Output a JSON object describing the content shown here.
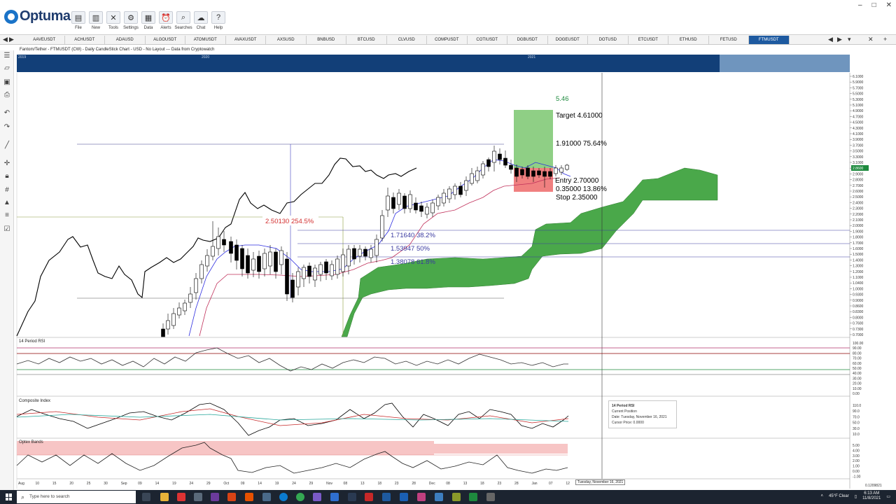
{
  "app": {
    "name": "Optuma"
  },
  "ribbon": {
    "buttons": [
      {
        "label": "File",
        "icon": "folder-icon",
        "glyph": "▤"
      },
      {
        "label": "New",
        "icon": "new-doc-icon",
        "glyph": "▥"
      },
      {
        "label": "Tools",
        "icon": "tools-icon",
        "glyph": "✕"
      },
      {
        "label": "Settings",
        "icon": "gear-icon",
        "glyph": "⚙"
      },
      {
        "label": "Data",
        "icon": "data-icon",
        "glyph": "▦"
      },
      {
        "label": "Alerts",
        "icon": "alarm-icon",
        "glyph": "⏰"
      },
      {
        "label": "Searches",
        "icon": "search-icon",
        "glyph": "⌕"
      },
      {
        "label": "Chat",
        "icon": "chat-icon",
        "glyph": "☁"
      },
      {
        "label": "Help",
        "icon": "help-icon",
        "glyph": "?"
      }
    ],
    "window_controls": [
      "–",
      "□",
      "✕"
    ]
  },
  "tabs": [
    "AAVEUSDT",
    "ACHUSDT",
    "ADAUSD",
    "ALGOUSDT",
    "ATOMUSDT",
    "AVAXUSDT",
    "AXSUSD",
    "BNBUSD",
    "BTCUSD",
    "CLVUSD",
    "COMPUSDT",
    "COTIUSDT",
    "DGBUSDT",
    "DOGEUSDT",
    "DOTUSD",
    "ETCUSDT",
    "ETHUSD",
    "FETUSD",
    "FTMUSDT"
  ],
  "active_tab": "FTMUSDT",
  "chart": {
    "title": "Fantom/Tether - FTMUSDT (CW) - Daily CandleStick Chart - USD - No Layout --- Data from Cryptowatch",
    "overview_years": [
      "2019",
      "2020",
      "2021"
    ],
    "price_axis": [
      "6.1000",
      "5.9000",
      "5.7000",
      "5.5000",
      "5.3000",
      "5.1000",
      "4.9000",
      "4.7000",
      "4.5000",
      "4.3000",
      "4.1000",
      "3.9000",
      "3.7000",
      "3.5000",
      "3.3000",
      "3.1000",
      "3.0000",
      "2.9000",
      "2.8000",
      "2.7000",
      "2.6000",
      "2.5000",
      "2.4000",
      "2.3000",
      "2.2000",
      "2.1000",
      "2.0000",
      "1.9000",
      "1.8000",
      "1.7000",
      "1.6000",
      "1.5000",
      "1.4000",
      "1.3000",
      "1.2000",
      "1.1000",
      "1.0400",
      "1.0000",
      "0.9300",
      "0.9000",
      "0.8600",
      "0.8300",
      "0.8000",
      "0.7600",
      "0.7300",
      "0.7000"
    ],
    "current_price": "2.8600",
    "annotations": {
      "top_value": "5.46",
      "target": "Target  4.61000",
      "gain": "1.91000   75.64%",
      "entry": "Entry  2.70000",
      "risk": "0.35000   13.86%",
      "stop": "Stop  2.35000",
      "measured_move": "2.50130   254.5%",
      "fib_382": "1.71640   38.2%",
      "fib_50": "1.53947   50%",
      "fib_618": "1.38078   61.8%"
    }
  },
  "rsi_panel": {
    "title": "14 Period RSI",
    "axis": [
      "100.00",
      "90.00",
      "80.00",
      "70.00",
      "60.00",
      "50.00",
      "40.00",
      "30.00",
      "20.00",
      "10.00",
      "0.00"
    ]
  },
  "composite_panel": {
    "title": "Composite Index",
    "axis": [
      "110.0",
      "90.0",
      "70.0",
      "50.0",
      "30.0",
      "10.0"
    ]
  },
  "optex_panel": {
    "title": "Optex Bands",
    "axis": [
      "5.00",
      "4.00",
      "3.00",
      "2.00",
      "1.00",
      "0.00",
      "-1.00"
    ]
  },
  "date_axis": [
    "Aug",
    "10",
    "15",
    "20",
    "25",
    "30",
    "Sep",
    "09",
    "14",
    "19",
    "24",
    "29",
    "Oct",
    "09",
    "14",
    "19",
    "24",
    "29",
    "Nov",
    "08",
    "13",
    "18",
    "23",
    "28",
    "Dec",
    "08",
    "13",
    "18",
    "23",
    "28",
    "Jan",
    "07",
    "12"
  ],
  "tooltip": {
    "title": "14 Period RSI",
    "line1": "Current Position",
    "line2": "Date: Tuesday, November 16, 2021",
    "line3": "Cursor Price: 0.0000"
  },
  "crosshair_date": "Tuesday, November 16, 2021",
  "axis_readout": "0.1209821",
  "taskbar": {
    "search_placeholder": "Type here to search",
    "weather": "45°F  Clear",
    "time": "6:13 AM",
    "date": "11/8/2021"
  },
  "colors": {
    "cloud": "#4aa84a",
    "target_box": "#8fcf85",
    "stop_box": "#f08080",
    "active_tab": "#1e5aa0",
    "overview": "#123f78"
  }
}
